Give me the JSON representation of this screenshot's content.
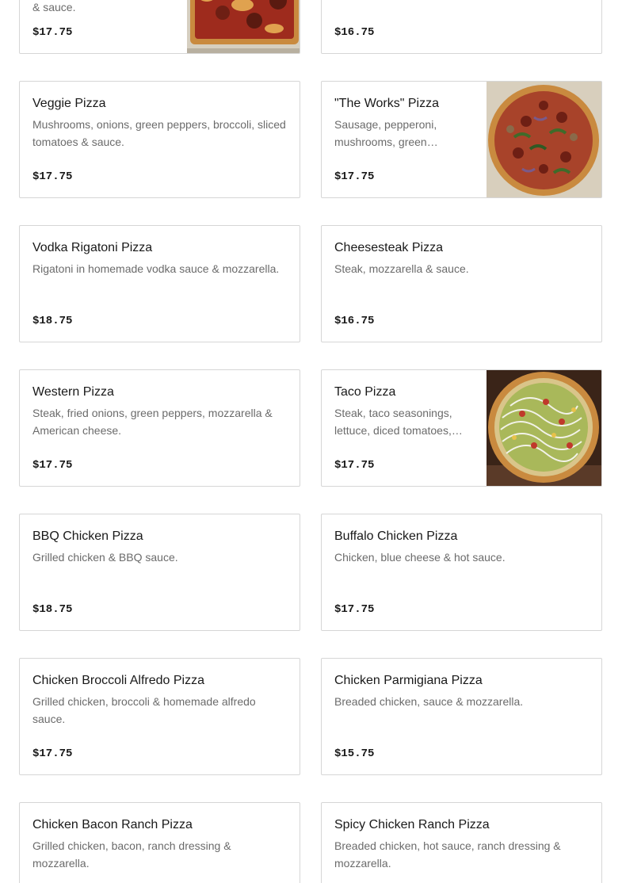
{
  "menu": {
    "items": [
      {
        "name": "",
        "description": "& sauce.",
        "price": "$17.75",
        "has_image": true,
        "image": "pizza-square-photo"
      },
      {
        "name": "",
        "description": "",
        "price": "$16.75",
        "has_image": false
      },
      {
        "name": "Veggie Pizza",
        "description": "Mushrooms, onions, green peppers, broccoli, sliced tomatoes & sauce.",
        "price": "$17.75",
        "has_image": false
      },
      {
        "name": "\"The Works\" Pizza",
        "description": "Sausage, pepperoni, mushrooms, green pepper…",
        "price": "$17.75",
        "has_image": true,
        "image": "works-pizza-photo"
      },
      {
        "name": "Vodka Rigatoni Pizza",
        "description": "Rigatoni in homemade vodka sauce & mozzarella.",
        "price": "$18.75",
        "has_image": false
      },
      {
        "name": "Cheesesteak Pizza",
        "description": "Steak, mozzarella & sauce.",
        "price": "$16.75",
        "has_image": false
      },
      {
        "name": "Western Pizza",
        "description": "Steak, fried onions, green peppers, mozzarella & American cheese.",
        "price": "$17.75",
        "has_image": false
      },
      {
        "name": "Taco Pizza",
        "description": "Steak, taco seasonings, lettuce, diced tomatoes,…",
        "price": "$17.75",
        "has_image": true,
        "image": "taco-pizza-photo"
      },
      {
        "name": "BBQ Chicken Pizza",
        "description": "Grilled chicken & BBQ sauce.",
        "price": "$18.75",
        "has_image": false
      },
      {
        "name": "Buffalo Chicken Pizza",
        "description": "Chicken, blue cheese & hot sauce.",
        "price": "$17.75",
        "has_image": false
      },
      {
        "name": "Chicken Broccoli Alfredo Pizza",
        "description": "Grilled chicken, broccoli & homemade alfredo sauce.",
        "price": "$17.75",
        "has_image": false
      },
      {
        "name": "Chicken Parmigiana Pizza",
        "description": "Breaded chicken, sauce & mozzarella.",
        "price": "$15.75",
        "has_image": false
      },
      {
        "name": "Chicken Bacon Ranch Pizza",
        "description": "Grilled chicken, bacon, ranch dressing & mozzarella.",
        "price": "",
        "has_image": false
      },
      {
        "name": "Spicy Chicken Ranch Pizza",
        "description": "Breaded chicken, hot sauce, ranch dressing & mozzarella.",
        "price": "",
        "has_image": false
      }
    ]
  },
  "colors": {
    "border": "#d6d6d6",
    "title": "#191919",
    "description": "#6b6b6b",
    "crust": "#c98a3f",
    "sauce": "#9e2b1d",
    "cheese": "#e8c27a",
    "tray": "#b8b0a0"
  }
}
